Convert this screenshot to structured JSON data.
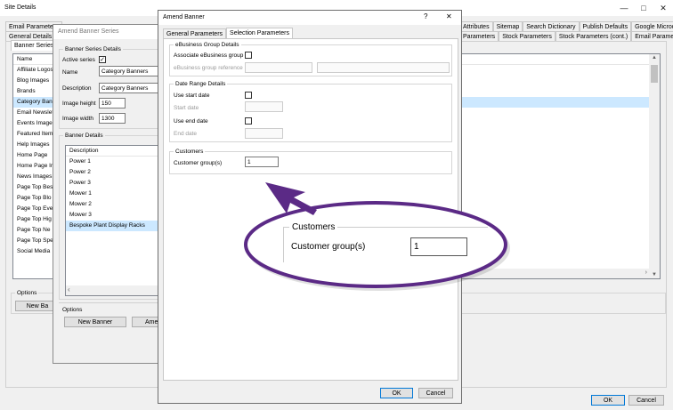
{
  "site": {
    "title": "Site Details",
    "tabs_row1": [
      "Email Parameters",
      "Attributes",
      "Sitemap",
      "Search Dictionary",
      "Publish Defaults",
      "Google Microdata"
    ],
    "tabs_row2": [
      "General Details",
      "Parameters",
      "Stock Parameters",
      "Stock Parameters (cont.)",
      "Email Parameters"
    ],
    "inner_tab": "Banner Series",
    "list_header": "Name",
    "list_items": [
      "Affiliate Logos",
      "Blog Images",
      "Brands",
      "Category Banners",
      "Email Newsletter",
      "Events Images",
      "Featured Items",
      "Help Images",
      "Home Page",
      "Home Page Images",
      "News Images",
      "Page Top Best",
      "Page Top Blog",
      "Page Top Events",
      "Page Top High",
      "Page Top News",
      "Page Top Specials",
      "Social Media"
    ],
    "list_items_display": [
      "Affiliate Logos",
      "Blog Images",
      "Brands",
      "Category Bann",
      "Email Newslet",
      "Events Image",
      "Featured Item",
      "Help Images",
      "Home Page",
      "Home Page Ir",
      "News Images",
      "Page Top Bes",
      "Page Top Blo",
      "Page Top Eve",
      "Page Top Hig",
      "Page Top Ne",
      "Page Top Spe",
      "Social Media"
    ],
    "selected_index": 3,
    "options_label": "Options",
    "new_button": "New Ba",
    "ok": "OK",
    "cancel": "Cancel"
  },
  "series": {
    "title": "Amend Banner Series",
    "group_details": "Banner Series Details",
    "active_label": "Active series",
    "active_checked": "✓",
    "name_label": "Name",
    "name_value": "Category Banners",
    "desc_label": "Description",
    "desc_value": "Category Banners",
    "height_label": "Image height",
    "height_value": "150",
    "width_label": "Image width",
    "width_value": "1300",
    "group_banners": "Banner Details",
    "list_header": "Description",
    "banners": [
      "Power 1",
      "Power 2",
      "Power 3",
      "Mower 1",
      "Mower 2",
      "Mower 3",
      "Bespoke Plant Display Racks"
    ],
    "selected_index": 6,
    "options_label": "Options",
    "new_banner": "New Banner",
    "amend": "Amen"
  },
  "amend": {
    "title": "Amend Banner",
    "help": "?",
    "close": "✕",
    "tabs": [
      "General Parameters",
      "Selection Parameters"
    ],
    "active_tab": 1,
    "ebiz_group": "eBusiness Group Details",
    "assoc_label": "Associate eBusiness group",
    "ebiz_ref_label": "eBusiness group reference",
    "date_group": "Date Range Details",
    "use_start": "Use start date",
    "start_date": "Start date",
    "use_end": "Use end date",
    "end_date": "End date",
    "cust_group": "Customers",
    "cust_label": "Customer group(s)",
    "cust_value": "1",
    "ok": "OK",
    "cancel": "Cancel"
  },
  "callout": {
    "group": "Customers",
    "label": "Customer group(s)",
    "value": "1"
  },
  "colors": {
    "accent": "#5b2a86",
    "selection": "#cce8ff",
    "default_button_border": "#0078d7"
  }
}
